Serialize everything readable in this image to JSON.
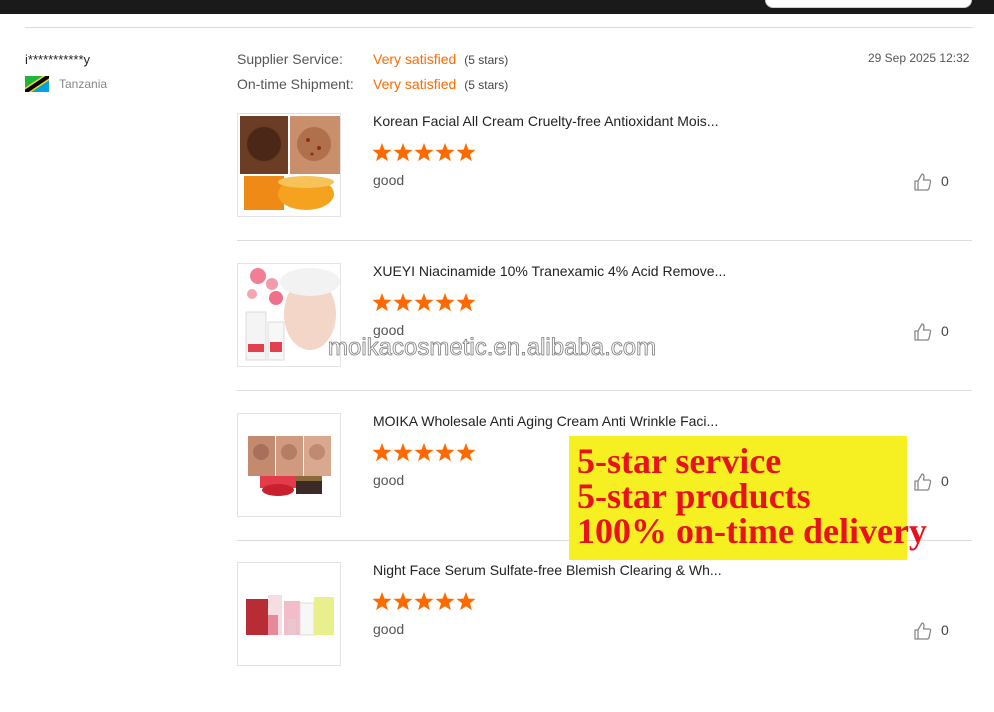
{
  "colors": {
    "accent": "#ff6a00",
    "promo_bg": "#f6ef21",
    "promo_text": "#e8121b"
  },
  "review": {
    "reviewer": "i***********y",
    "country": "Tanzania",
    "flag_icon": "tanzania-flag-icon",
    "date": "29 Sep 2025 12:32",
    "supplier_service": {
      "label": "Supplier Service:",
      "value": "Very satisfied",
      "stars": "(5 stars)"
    },
    "on_time_shipment": {
      "label": "On-time Shipment:",
      "value": "Very satisfied",
      "stars": "(5 stars)"
    }
  },
  "products": [
    {
      "title": "Korean Facial All Cream Cruelty-free Antioxidant Mois...",
      "rating": 5,
      "comment": "good",
      "likes": "0"
    },
    {
      "title": "XUEYI Niacinamide 10% Tranexamic 4% Acid Remove...",
      "rating": 5,
      "comment": "good",
      "likes": "0"
    },
    {
      "title": "MOIKA Wholesale Anti Aging Cream Anti Wrinkle Faci...",
      "rating": 5,
      "comment": "good",
      "likes": "0"
    },
    {
      "title": "Night Face Serum Sulfate-free Blemish Clearing & Wh...",
      "rating": 5,
      "comment": "good",
      "likes": "0"
    }
  ],
  "watermark": "moikacosmetic.en.alibaba.com",
  "promo": {
    "line1": "5-star service",
    "line2": "5-star products",
    "line3": "100% on-time delivery"
  }
}
